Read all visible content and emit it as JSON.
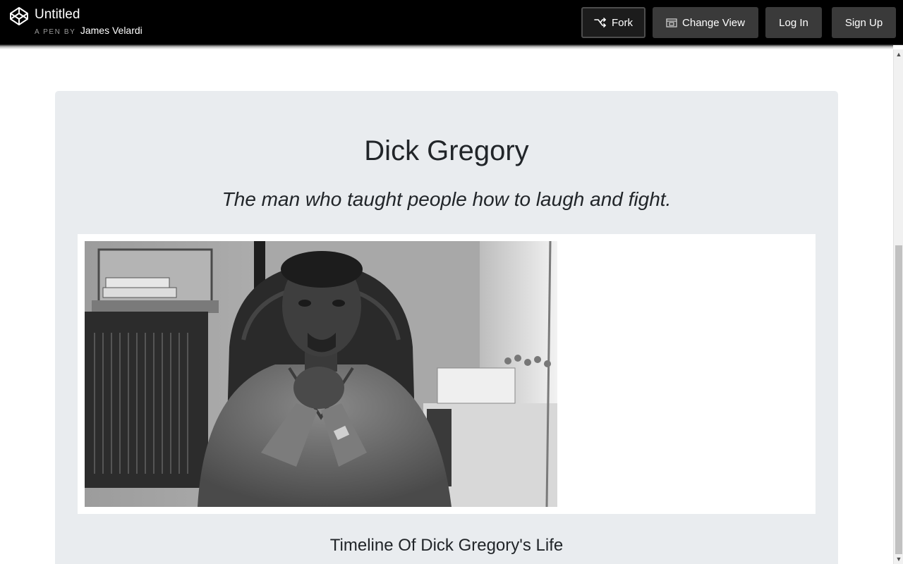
{
  "header": {
    "pen_title": "Untitled",
    "byline_label": "A PEN BY",
    "author": "James Velardi",
    "buttons": {
      "fork": "Fork",
      "change_view": "Change View",
      "login": "Log In",
      "signup": "Sign Up"
    },
    "icons": {
      "logo": "codepen-logo-icon",
      "fork": "fork-icon",
      "change_view": "change-view-icon"
    }
  },
  "page": {
    "title": "Dick Gregory",
    "subtitle": "The man who taught people how to laugh and fight.",
    "image_caption": "",
    "section_heading": "Timeline Of Dick Gregory's Life"
  },
  "colors": {
    "header_bg": "#000000",
    "button_bg": "#3a3a3a",
    "card_bg": "#e9ecef",
    "text": "#212529"
  }
}
